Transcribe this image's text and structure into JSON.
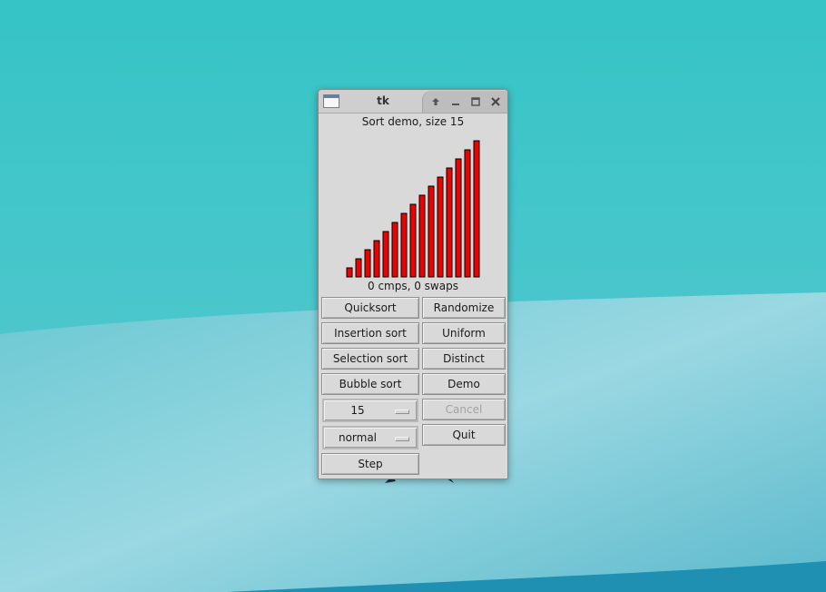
{
  "window": {
    "title": "tk"
  },
  "titlebar_icons": [
    "up-arrow-icon",
    "minimize-icon",
    "maximize-icon",
    "close-icon"
  ],
  "heading": "Sort demo, size 15",
  "chart_data": {
    "type": "bar",
    "values": [
      1,
      2,
      3,
      4,
      5,
      6,
      7,
      8,
      9,
      10,
      11,
      12,
      13,
      14,
      15
    ],
    "color": "#ee0000",
    "grid": false
  },
  "status": "0 cmps, 0 swaps",
  "buttons": {
    "quicksort": "Quicksort",
    "insertion_sort": "Insertion sort",
    "selection_sort": "Selection sort",
    "bubble_sort": "Bubble sort",
    "step": "Step",
    "randomize": "Randomize",
    "uniform": "Uniform",
    "distinct": "Distinct",
    "demo": "Demo",
    "cancel": "Cancel",
    "quit": "Quit"
  },
  "menus": {
    "size_value": "15",
    "speed_value": "normal"
  },
  "colors": {
    "bar_fill": "#ee0000",
    "window_bg": "#d9d9d9",
    "desktop": "#3fc3c7"
  }
}
